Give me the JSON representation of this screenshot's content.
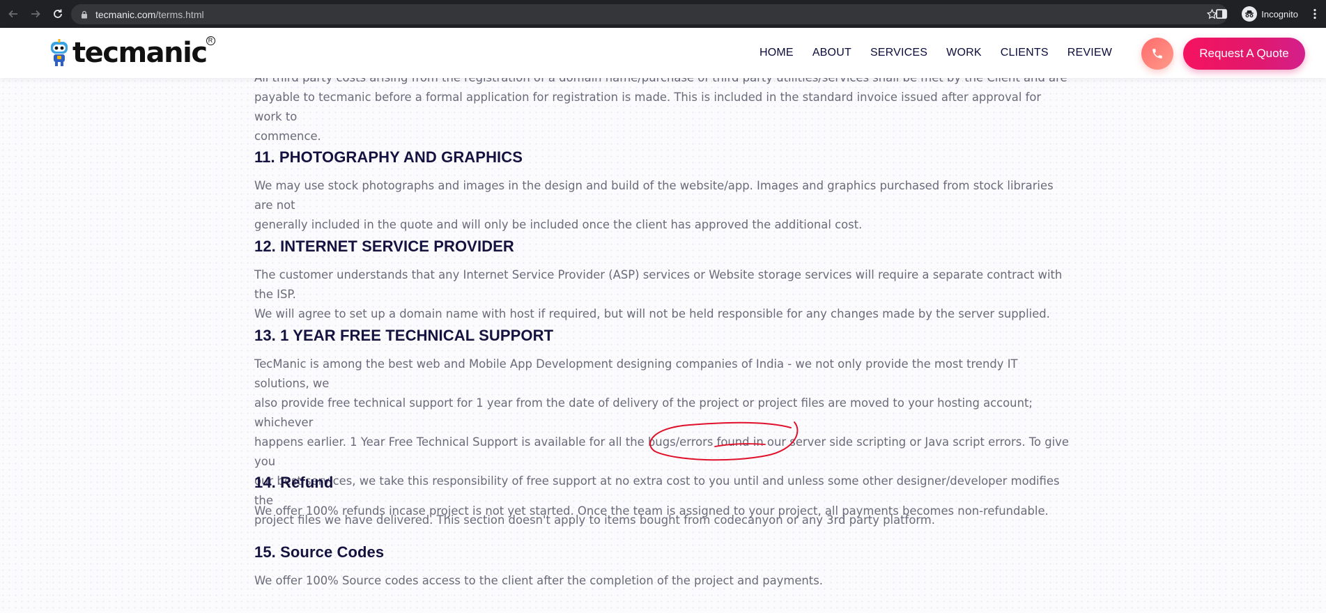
{
  "browser": {
    "url_host": "tecmanic.com",
    "url_path": "/terms.html",
    "profile_label": "Incognito"
  },
  "header": {
    "logo_text": "tecmanic",
    "logo_reg": "R",
    "nav": [
      "HOME",
      "ABOUT",
      "SERVICES",
      "WORK",
      "CLIENTS",
      "REVIEW"
    ],
    "quote_label": "Request A Quote"
  },
  "content": {
    "intro_lines": [
      "All third party costs arising from the registration of a domain name/purchase of third party utilities/services shall be met by the Client and are",
      "payable to tecmanic before a formal application for registration is made. This is included in the standard invoice issued after approval for work to",
      "commence."
    ],
    "sections": [
      {
        "heading": "11. PHOTOGRAPHY AND GRAPHICS",
        "lines": [
          "We may use stock photographs and images in the design and build of the website/app. Images and graphics purchased from stock libraries are not",
          "generally included in the quote and will only be included once the client has approved the additional cost."
        ]
      },
      {
        "heading": "12. INTERNET SERVICE PROVIDER",
        "lines": [
          "The customer understands that any Internet Service Provider (ASP) services or Website storage services will require a separate contract with the ISP.",
          "We will agree to set up a domain name with host if required, but will not be held responsible for any changes made by the server supplied."
        ]
      },
      {
        "heading": "13. 1 YEAR FREE TECHNICAL SUPPORT",
        "lines": [
          "TecManic is among the best web and Mobile App Development designing companies of India - we not only provide the most trendy IT solutions, we",
          "also provide free technical support for 1 year from the date of delivery of the project or project files are moved to your hosting account; whichever",
          "happens earlier. 1 Year Free Technical Support is available for all the bugs/errors found in our server side scripting or Java script errors. To give you",
          "our best services, we take this responsibility of free support at no extra cost to you until and unless some other designer/developer modifies the",
          "project files we have delivered. This section doesn't apply to items bought from codecanyon or any 3rd party platform."
        ]
      },
      {
        "heading": "14. Refund",
        "lines": [
          "We offer 100% refunds incase project is not yet started. Once the team is assigned to your project, all payments becomes non-refundable."
        ]
      },
      {
        "heading": "15. Source Codes",
        "lines": [
          "We offer 100% Source codes access to the client after the completion of the project and payments."
        ]
      }
    ]
  },
  "colors": {
    "heading": "#14123f",
    "body_text": "#6a6a7a",
    "accent_pink": "#e1186c",
    "annotation_red": "#e0102a"
  },
  "icons": [
    "back-arrow-icon",
    "forward-arrow-icon",
    "reload-icon",
    "lock-icon",
    "star-icon",
    "side-panel-icon",
    "incognito-icon",
    "kebab-menu-icon",
    "phone-icon"
  ]
}
